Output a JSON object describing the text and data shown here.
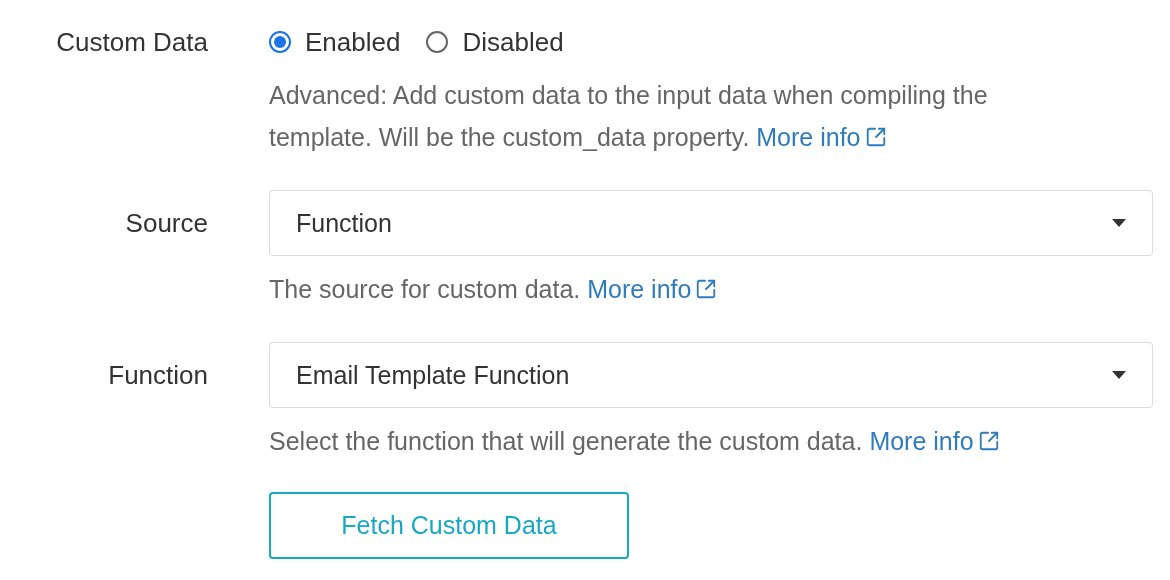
{
  "fields": [
    {
      "kind": "radio",
      "label": "Custom Data",
      "options": [
        {
          "label": "Enabled",
          "selected": true
        },
        {
          "label": "Disabled",
          "selected": false
        }
      ],
      "help": "Advanced: Add custom data to the input data when compiling the template. Will be the custom_data property.",
      "link": "More info"
    },
    {
      "kind": "select",
      "label": "Source",
      "value": "Function",
      "help": "The source for custom data.",
      "link": "More info"
    },
    {
      "kind": "select",
      "label": "Function",
      "value": "Email Template Function",
      "help": "Select the function that will generate the custom data.",
      "link": "More info"
    }
  ],
  "button": "Fetch Custom Data"
}
